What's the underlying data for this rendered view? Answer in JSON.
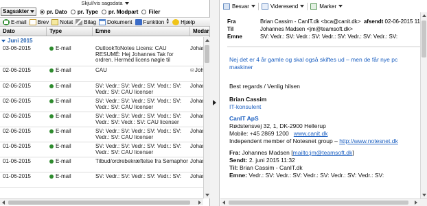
{
  "left": {
    "toggle_label": "Skjul/vis sagsdata",
    "filter": {
      "select_value": "Sagsakter",
      "options": [
        {
          "label": "pr. Dato",
          "selected": true
        },
        {
          "label": "pr. Type",
          "selected": false
        },
        {
          "label": "pr. Modpart",
          "selected": false
        },
        {
          "label": "Filer",
          "selected": false
        }
      ]
    },
    "toolbar": {
      "email": "E-mail",
      "brev": "Brev",
      "notat": "Notat",
      "bilag": "Bilag",
      "dokument": "Dokument",
      "funktion": "Funktion",
      "hjaelp": "Hjælp"
    },
    "columns": {
      "dato": "Dato",
      "type": "Type",
      "emne": "Emne",
      "medarbejder": "Medarbe"
    },
    "group_label": "Juni 2015",
    "rows": [
      {
        "date": "03-06-2015",
        "type": "E-mail",
        "subject": "OutlookToNotes Licens: CAU RESUMÉ: Hej Johannes Tak for ordren. Hermed licens nøgle til",
        "employee": "Johan",
        "attachment": false,
        "height": "h3"
      },
      {
        "date": "02-06-2015",
        "type": "E-mail",
        "subject": "CAU",
        "employee": "Johan",
        "attachment": true,
        "height": "h1"
      },
      {
        "date": "02-06-2015",
        "type": "E-mail",
        "subject": "SV: Vedr.: SV: Vedr.: SV: Vedr.: SV: Vedr.: SV: CAU licenser",
        "employee": "Johan",
        "attachment": false,
        "height": "h2"
      },
      {
        "date": "02-06-2015",
        "type": "E-mail",
        "subject": "SV: Vedr.: SV: Vedr.: SV: Vedr.: SV: Vedr.: SV: CAU licenser",
        "employee": "Johan",
        "attachment": false,
        "height": "h2"
      },
      {
        "date": "02-06-2015",
        "type": "E-mail",
        "subject": "SV: Vedr.: SV: Vedr.: SV: Vedr.: SV: Vedr.: SV: Vedr.: SV: CAU licenser",
        "employee": "Johan",
        "attachment": false,
        "height": "h2"
      },
      {
        "date": "02-06-2015",
        "type": "E-mail",
        "subject": "SV: Vedr.: SV: Vedr.: SV: Vedr.: SV: Vedr.: SV: CAU licenser",
        "employee": "Johan",
        "attachment": false,
        "height": "h2"
      },
      {
        "date": "01-06-2015",
        "type": "E-mail",
        "subject": "SV: Vedr.: SV: Vedr.: SV: Vedr.: SV: Vedr.: SV: CAU licenser",
        "employee": "Johan",
        "attachment": false,
        "height": "h2"
      },
      {
        "date": "01-06-2015",
        "type": "E-mail",
        "subject": "Tilbud/ordrebekræftelse fra Semaphor",
        "employee": "Johan",
        "attachment": false,
        "height": "h2"
      },
      {
        "date": "01-06-2015",
        "type": "E-mail",
        "subject": "SV: Vedr.: SV: Vedr.: SV: Vedr.: SV:",
        "employee": "Johan",
        "attachment": false,
        "height": "h2"
      }
    ]
  },
  "right": {
    "toolbar": {
      "besvar": "Besvar",
      "videresend": "Videresend",
      "marker": "Marker"
    },
    "header": {
      "fra_label": "Fra",
      "fra_value": "Brian Cassim - CanIT.dk <bca@canit.dk>",
      "afsendt_label": "afsendt",
      "afsendt_value": "02-06-2015 11",
      "til_label": "Til",
      "til_value": "Johannes Madsen <jm@teamsoft.dk>",
      "emne_label": "Emne",
      "emne_value": "SV: Vedr.: SV: Vedr.: SV: Vedr.: SV: Vedr.: SV: Vedr.: SV:"
    },
    "body": {
      "intro": "Nej det er 4 år gamle og skal også skiftes ud – men de får nye pc maskiner",
      "greeting": "Best regards / Venlig hilsen",
      "sig_name": "Brian Cassim",
      "sig_title": "IT-konsulent",
      "company": "CanIT ApS",
      "address": "Rødstensvej 32, 1, DK-2900 Hellerup",
      "mobile_prefix": "Mobile: +45 2869 1200",
      "website": "www.canit.dk",
      "notesnet_prefix": "Independent member of Notesnet group –",
      "notesnet_link": "http://www.notesnet.dk",
      "fw_fra_label": "Fra:",
      "fw_fra_value": "Johannes Madsen [",
      "fw_fra_link": "mailto:jm@teamsoft.dk",
      "fw_fra_end": "]",
      "fw_sendt_label": "Sendt:",
      "fw_sendt_value": "2. juni 2015 11:32",
      "fw_til_label": "Til:",
      "fw_til_value": "Brian Cassim - CanIT.dk",
      "fw_emne_label": "Emne:",
      "fw_emne_value": "Vedr.: SV: Vedr.: SV: Vedr.: SV: Vedr.: SV: Vedr.: SV:"
    }
  },
  "colors": {
    "group_blue": "#1f5fb0",
    "email_green": "#2e8b2e",
    "body_blue": "#1b5fc1"
  }
}
